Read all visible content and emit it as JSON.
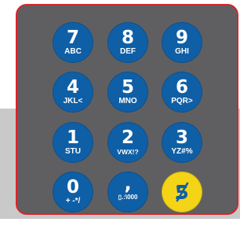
{
  "colors": {
    "panel": "#5f5f61",
    "panel_border": "#d8242b",
    "key_blue": "#0f5fa6",
    "key_cancel": "#f4d417",
    "key_text": "#ffffff",
    "background_band": "#c9c9c9"
  },
  "keypad": {
    "keys": [
      {
        "main": "7",
        "sub": "ABC"
      },
      {
        "main": "8",
        "sub": "DEF"
      },
      {
        "main": "9",
        "sub": "GHI"
      },
      {
        "main": "4",
        "sub": "JKL<"
      },
      {
        "main": "5",
        "sub": "MNO"
      },
      {
        "main": "6",
        "sub": "PQR>"
      },
      {
        "main": "1",
        "sub": "STU"
      },
      {
        "main": "2",
        "sub": "VWX!?"
      },
      {
        "main": "3",
        "sub": "YZ#%"
      },
      {
        "main": "0",
        "sub": "+ -*/"
      },
      {
        "main": ",",
        "sub": "▯.:\\000"
      }
    ],
    "cancel_icon": "cancel-slash-icon"
  }
}
